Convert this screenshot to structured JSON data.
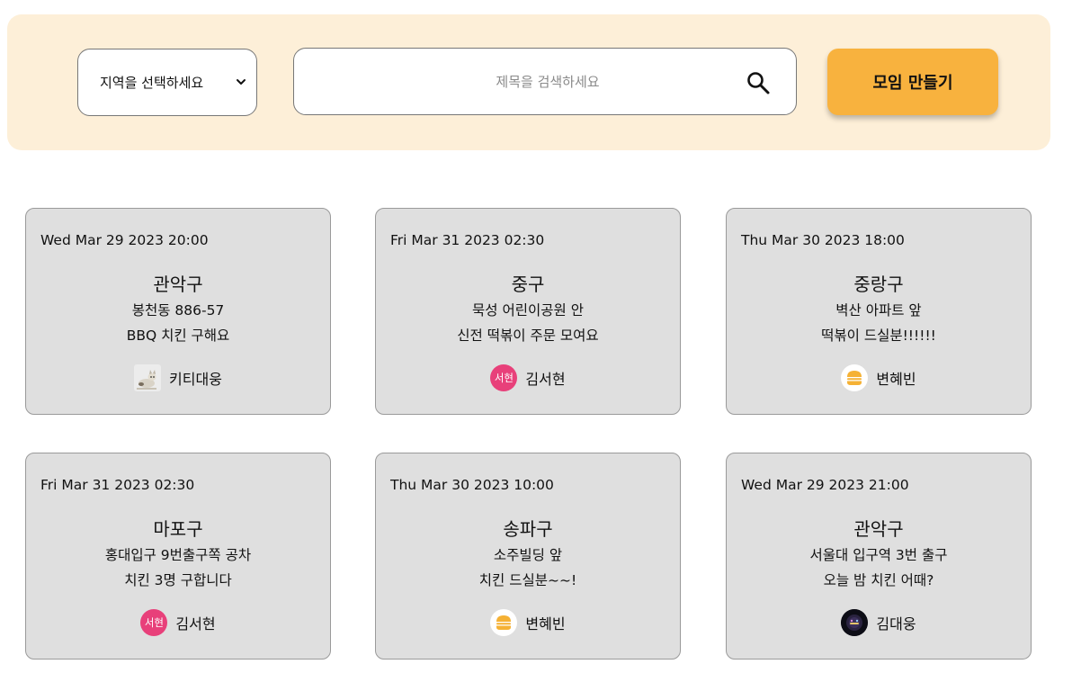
{
  "header": {
    "region_select": {
      "value": "지역을 선택하세요",
      "icon": "chevron-down-icon"
    },
    "search": {
      "placeholder": "제목을 검색하세요",
      "value": "",
      "icon": "search-icon"
    },
    "create_button": "모임 만들기",
    "colors": {
      "bar_bg": "#fdefd8",
      "accent": "#f8b23e"
    }
  },
  "cards": [
    {
      "date": "Wed Mar 29 2023 20:00",
      "region": "관악구",
      "place": "봉천동 886-57",
      "title": "BBQ 치킨 구해요",
      "host": {
        "name": "키티대웅",
        "avatar": "cat-photo"
      }
    },
    {
      "date": "Fri Mar 31 2023 02:30",
      "region": "중구",
      "place": "묵성 어린이공원 안",
      "title": "신전 떡볶이 주문 모여요",
      "host": {
        "name": "김서현",
        "avatar": "text",
        "avatar_text": "서현",
        "avatar_color": "#e8407a"
      }
    },
    {
      "date": "Thu Mar 30 2023 18:00",
      "region": "중랑구",
      "place": "벽산 아파트 앞",
      "title": "떡볶이 드실분!!!!!!",
      "host": {
        "name": "변혜빈",
        "avatar": "burger-icon"
      }
    },
    {
      "date": "Fri Mar 31 2023 02:30",
      "region": "마포구",
      "place": "홍대입구 9번출구쪽 공차",
      "title": "치킨 3명 구합니다",
      "host": {
        "name": "김서현",
        "avatar": "text",
        "avatar_text": "서현",
        "avatar_color": "#e8407a"
      }
    },
    {
      "date": "Thu Mar 30 2023 10:00",
      "region": "송파구",
      "place": "소주빌딩 앞",
      "title": "치킨 드실분~~!",
      "host": {
        "name": "변혜빈",
        "avatar": "burger-icon"
      }
    },
    {
      "date": "Wed Mar 29 2023 21:00",
      "region": "관악구",
      "place": "서울대 입구역 3번 출구",
      "title": "오늘 밤 치킨 어때?",
      "host": {
        "name": "김대웅",
        "avatar": "dark-logo"
      }
    }
  ]
}
